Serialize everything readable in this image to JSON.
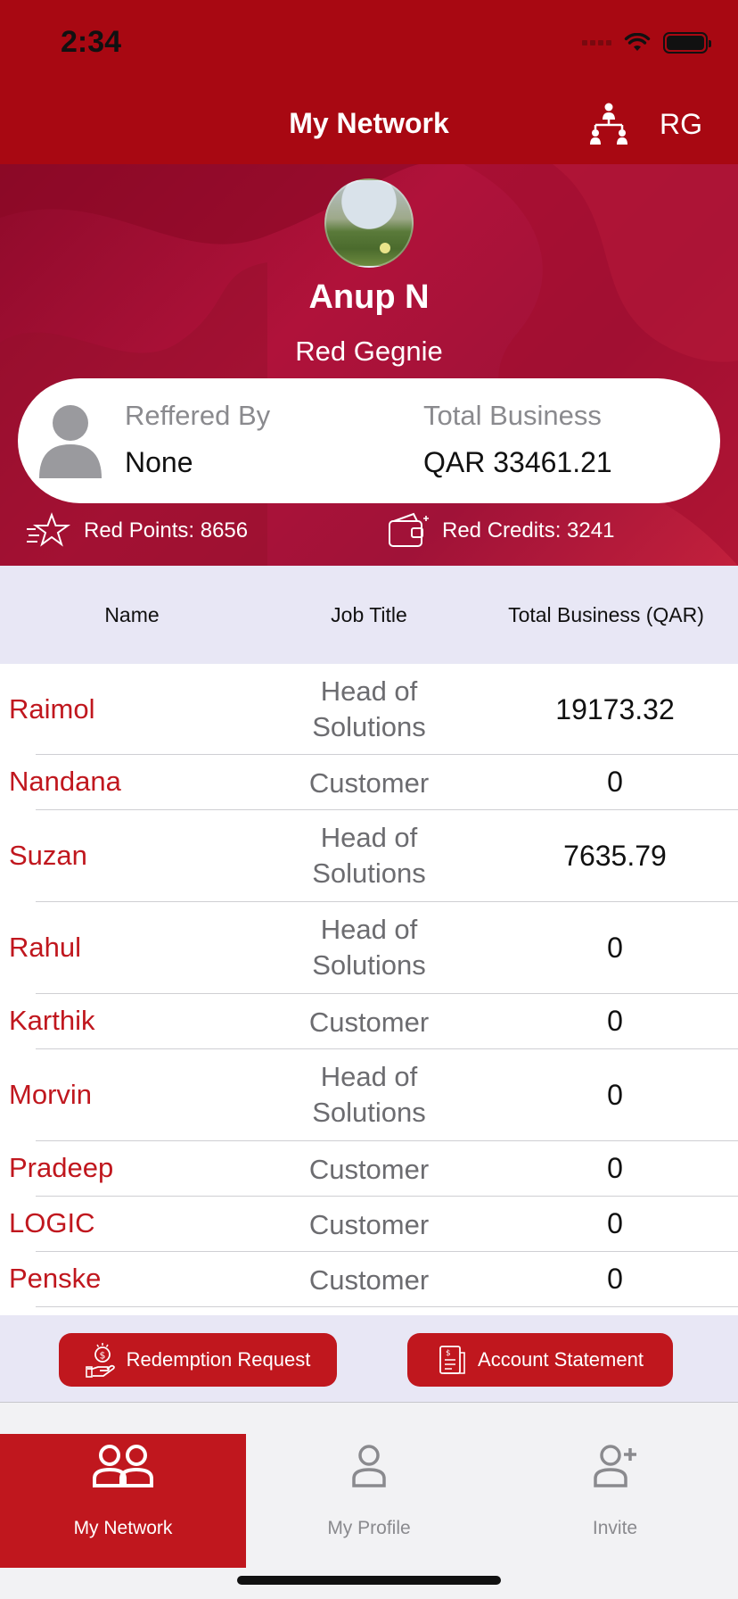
{
  "status_bar": {
    "time": "2:34"
  },
  "nav": {
    "title": "My Network",
    "right_label": "RG",
    "tree_icon": "hierarchy-icon"
  },
  "profile": {
    "name": "Anup N",
    "role": "Red Gegnie",
    "referred_by_label": "Reffered By",
    "referred_by_value": "None",
    "total_business_label": "Total Business",
    "total_business_value": "QAR 33461.21",
    "red_points": "Red Points: 8656",
    "red_credits": "Red Credits: 3241"
  },
  "table": {
    "headers": [
      "Name",
      "Job Title",
      "Total Business (QAR)"
    ],
    "rows": [
      {
        "name": "Raimol",
        "job": "Head of Solutions",
        "total": "19173.32"
      },
      {
        "name": "Nandana",
        "job": "Customer",
        "total": "0"
      },
      {
        "name": "Suzan",
        "job": "Head of Solutions",
        "total": "7635.79"
      },
      {
        "name": "Rahul",
        "job": "Head of Solutions",
        "total": "0"
      },
      {
        "name": "Karthik",
        "job": "Customer",
        "total": "0"
      },
      {
        "name": "Morvin",
        "job": "Head of Solutions",
        "total": "0"
      },
      {
        "name": "Pradeep",
        "job": "Customer",
        "total": "0"
      },
      {
        "name": "LOGIC",
        "job": "Customer",
        "total": "0"
      },
      {
        "name": "Penske",
        "job": "Customer",
        "total": "0"
      }
    ]
  },
  "actions": {
    "redemption_label": "Redemption Request",
    "statement_label": "Account Statement"
  },
  "tabs": [
    {
      "label": "My Network",
      "icon": "network-users-icon",
      "active": true
    },
    {
      "label": "My Profile",
      "icon": "profile-icon",
      "active": false
    },
    {
      "label": "Invite",
      "icon": "add-user-icon",
      "active": false
    }
  ],
  "colors": {
    "brand_red": "#c0171e",
    "nav_red": "#a80812",
    "table_header_bg": "#e8e7f5"
  }
}
